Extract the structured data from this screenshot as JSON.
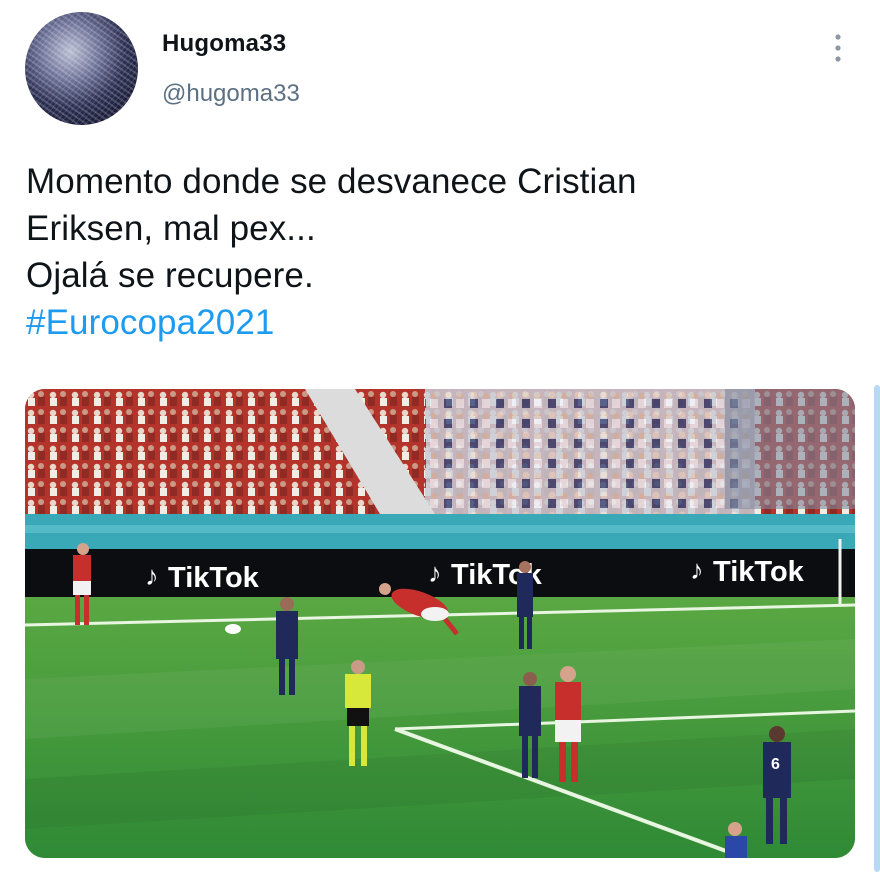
{
  "tweet": {
    "display_name": "Hugoma33",
    "handle": "@hugoma33",
    "text_lines": [
      "Momento donde se desvanece Cristian",
      "Eriksen, mal pex...",
      "Ojalá se recupere."
    ],
    "hashtag": "#Eurocopa2021",
    "more_icon": "vertical-ellipsis-icon"
  },
  "media": {
    "ad_boards": [
      "TikTok",
      "TikTok",
      "TikTok"
    ],
    "pitch_color": "#3f9a3a",
    "stands_color": "#b3362d",
    "brand_color": "#1d9bf0"
  }
}
